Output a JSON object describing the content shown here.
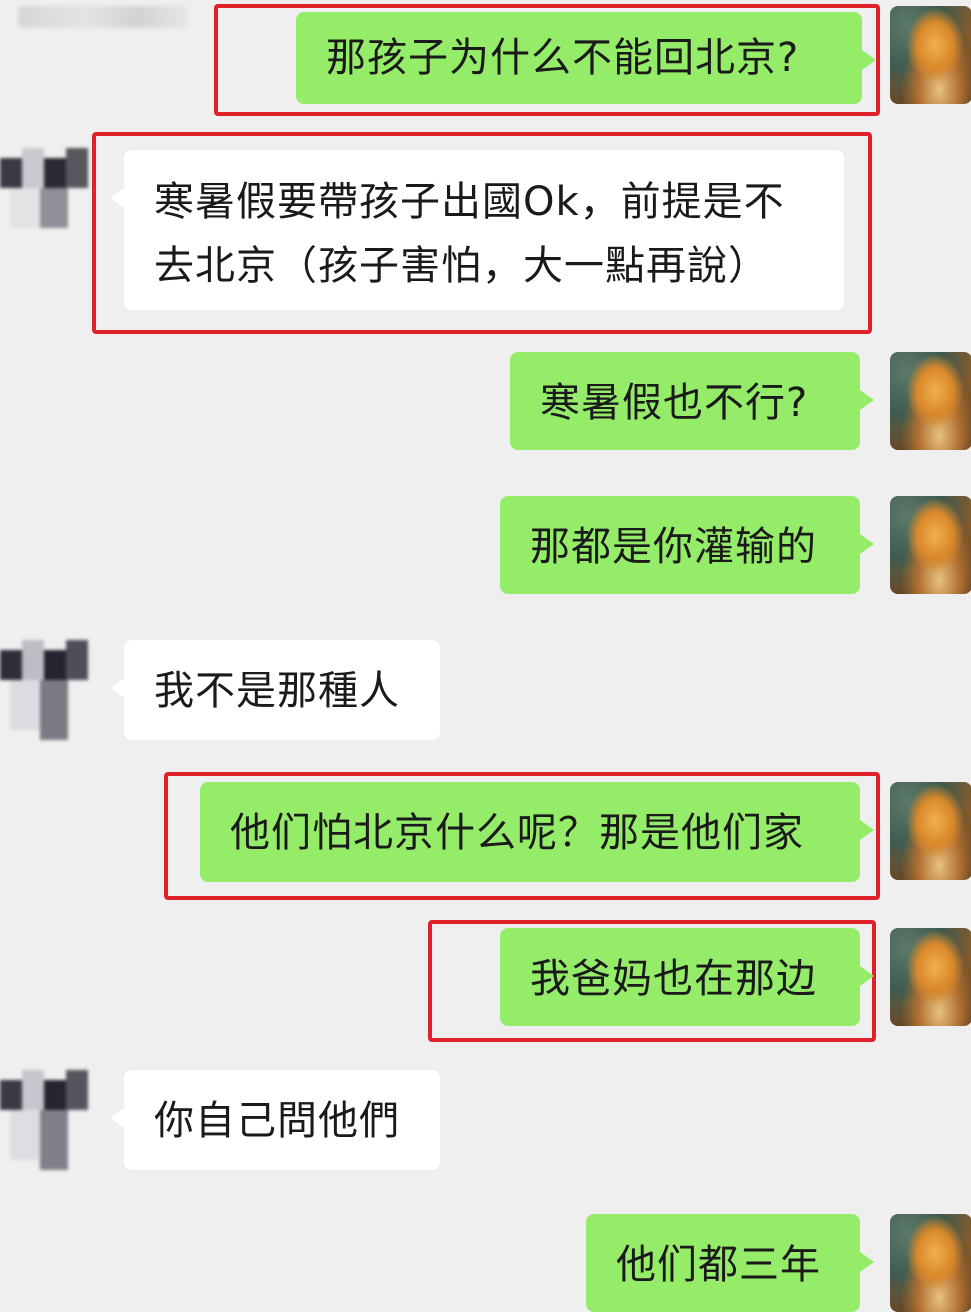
{
  "messages": [
    {
      "from": "me",
      "text": "那孩子为什么不能回北京?",
      "highlighted": true
    },
    {
      "from": "them",
      "text": "寒暑假要帶孩子出國Ok，前提是不去北京（孩子害怕，大一點再說）",
      "highlighted": true
    },
    {
      "from": "me",
      "text": "寒暑假也不行?",
      "highlighted": false
    },
    {
      "from": "me",
      "text": "那都是你灌输的",
      "highlighted": false
    },
    {
      "from": "them",
      "text": "我不是那種人",
      "highlighted": false
    },
    {
      "from": "me",
      "text": "他们怕北京什么呢？那是他们家",
      "highlighted": true
    },
    {
      "from": "me",
      "text": "我爸妈也在那边",
      "highlighted": true
    },
    {
      "from": "them",
      "text": "你自己問他們",
      "highlighted": false
    },
    {
      "from": "me",
      "text": "他们都三年",
      "highlighted": false
    }
  ],
  "colors": {
    "background": "#efefef",
    "me_bubble": "#95ec69",
    "them_bubble": "#ffffff",
    "highlight_border": "#e0202a"
  },
  "icons": {
    "me_avatar": "buddha-painting-avatar",
    "them_avatar": "pixelated-avatar"
  }
}
